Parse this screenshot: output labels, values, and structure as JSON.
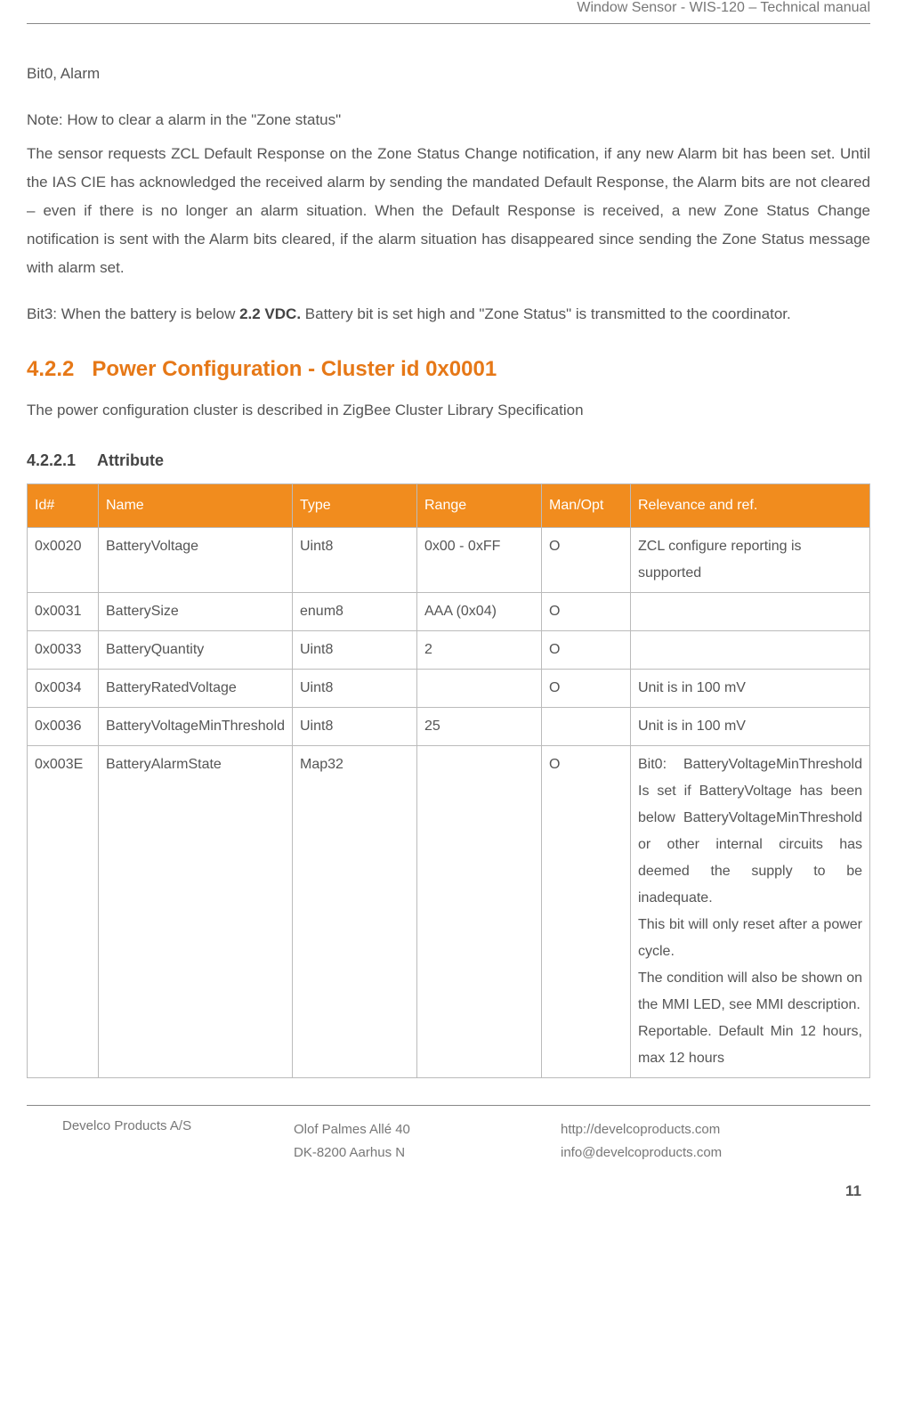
{
  "header": {
    "doc_title": "Window Sensor - WIS-120 – Technical manual"
  },
  "content": {
    "bit0_label": "Bit0, Alarm",
    "note_line": "Note: How to clear a alarm in the \"Zone status\"",
    "note_para": "The sensor requests ZCL Default Response on the Zone Status Change notification, if any new Alarm bit has been set. Until the IAS CIE has acknowledged the received alarm by sending the mandated Default Response, the Alarm bits are not cleared – even if there is no longer an alarm situation. When the Default Response is received, a new Zone Status Change notification is sent with the Alarm bits cleared, if the alarm situation has disappeared since sending the Zone Status message with alarm set.",
    "bit3_prefix": "Bit3:",
    "bit3_mid1": " When the battery is below ",
    "bit3_bold": "2.2 VDC.",
    "bit3_mid2": " Battery bit is set high and \"Zone Status\" is transmitted to the coordinator.",
    "section_num": "4.2.2",
    "section_title": "Power Configuration - Cluster id 0x0001",
    "section_intro": "The power configuration cluster is described in ZigBee Cluster Library Specification",
    "subsection_num": "4.2.2.1",
    "subsection_title": "Attribute"
  },
  "table": {
    "headers": {
      "id": "Id#",
      "name": "Name",
      "type": "Type",
      "range": "Range",
      "manopt": "Man/Opt",
      "relevance": "Relevance and ref."
    },
    "rows": [
      {
        "id": "0x0020",
        "name": "BatteryVoltage",
        "type": "Uint8",
        "range": "0x00 - 0xFF",
        "manopt": "O",
        "relevance": "ZCL configure reporting is supported"
      },
      {
        "id": "0x0031",
        "name": "BatterySize",
        "type": "enum8",
        "range": "AAA (0x04)",
        "manopt": "O",
        "relevance": ""
      },
      {
        "id": "0x0033",
        "name": "BatteryQuantity",
        "type": "Uint8",
        "range": "2",
        "manopt": "O",
        "relevance": ""
      },
      {
        "id": "0x0034",
        "name": "BatteryRatedVoltage",
        "type": "Uint8",
        "range": "",
        "manopt": "O",
        "relevance": "Unit is in 100 mV"
      },
      {
        "id": "0x0036",
        "name": "BatteryVoltageMinThreshold",
        "type": "Uint8",
        "range": "25",
        "manopt": "",
        "relevance": "Unit is in 100 mV"
      },
      {
        "id": "0x003E",
        "name": "BatteryAlarmState",
        "type": "Map32",
        "range": "",
        "manopt": "O",
        "relevance": "Bit0: BatteryVoltageMinThreshold Is set if BatteryVoltage has been below BatteryVoltageMinThreshold or other internal circuits has deemed the supply to be inadequate.\nThis bit will only reset after a power cycle.\nThe condition will also be shown on the MMI LED, see MMI description.\nReportable. Default Min 12 hours, max 12 hours"
      }
    ]
  },
  "footer": {
    "company": "Develco Products A/S",
    "addr1": "Olof Palmes Allé 40",
    "addr2": "DK-8200 Aarhus N",
    "url": "http://develcoproducts.com",
    "email": "info@develcoproducts.com",
    "page": "11"
  }
}
